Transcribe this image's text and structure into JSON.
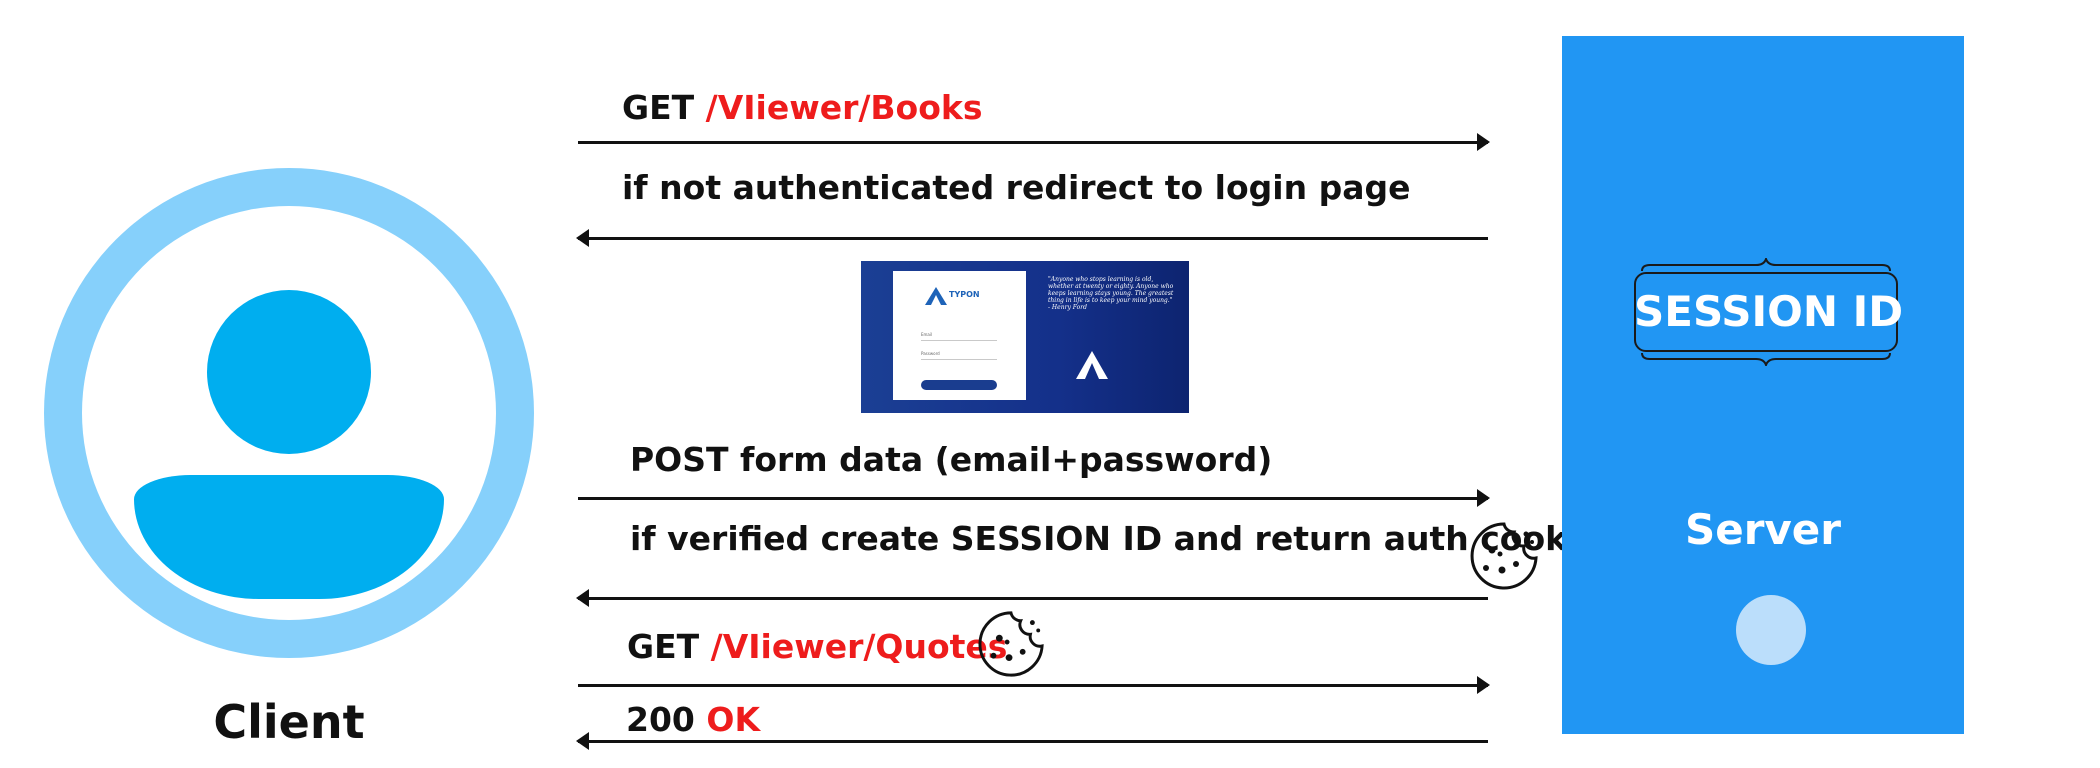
{
  "client": {
    "label": "Client",
    "icon": "user-avatar-icon"
  },
  "server": {
    "label": "Server",
    "session_label": "SESSION ID",
    "panel_color": "#2196f3"
  },
  "messages": {
    "m1": {
      "method": "GET",
      "path": "/VIiewer/Books"
    },
    "m2": {
      "text": "if not authenticated redirect to login page"
    },
    "m3": {
      "text": "POST form data (email+password)"
    },
    "m4": {
      "text": "if verified create SESSION ID and return auth cookie"
    },
    "m5": {
      "method": "GET",
      "path": "/VIiewer/Quotes"
    },
    "m6": {
      "code": "200",
      "status": "OK"
    }
  },
  "login_preview": {
    "brand": "TYPON",
    "quote": "\"Anyone who stops learning is old, whether at twenty or eighty. Anyone who keeps learning stays young. The greatest thing in life is to keep your mind young.\" - Henry Ford",
    "fields": [
      "Email",
      "Password"
    ],
    "password_value": "Password"
  },
  "colors": {
    "accent_red": "#ee1c1c",
    "client_ring": "#86d0fb",
    "client_figure": "#00aeef"
  }
}
